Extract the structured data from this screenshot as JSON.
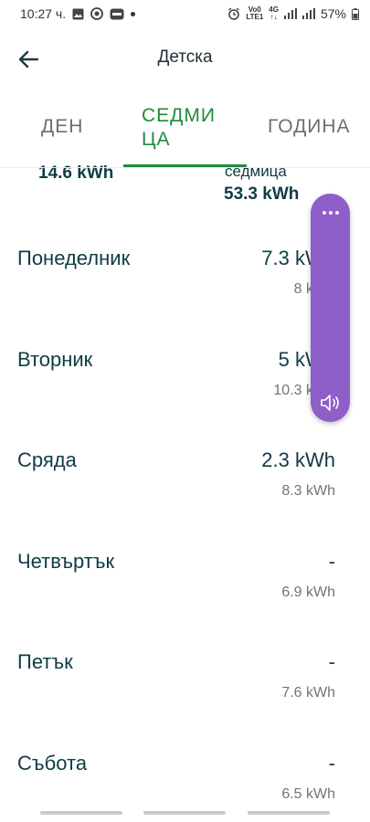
{
  "status_bar": {
    "time": "10:27 ч.",
    "net_top": "Vo0",
    "net_bottom": "LTE1",
    "net2_top": "4G",
    "battery": "57%"
  },
  "app_bar": {
    "title": "Детска"
  },
  "tabs": [
    {
      "label": "ДЕН",
      "active": false
    },
    {
      "label": "СЕДМИ ЦА",
      "active": true
    },
    {
      "label": "ГОДИНА",
      "active": false
    }
  ],
  "summary": {
    "left_value": "14.6 kWh",
    "right_label": "седмица",
    "right_value": "53.3 kWh"
  },
  "days": [
    {
      "name": "Понеделник",
      "value": "7.3 kWh",
      "prev": "8 kWh"
    },
    {
      "name": "Вторник",
      "value": "5 kWh",
      "prev": "10.3 kWh"
    },
    {
      "name": "Сряда",
      "value": "2.3 kWh",
      "prev": "8.3 kWh"
    },
    {
      "name": "Четвъртък",
      "value": "-",
      "prev": "6.9 kWh"
    },
    {
      "name": "Петък",
      "value": "-",
      "prev": "7.6 kWh"
    },
    {
      "name": "Събота",
      "value": "-",
      "prev": "6.5 kWh"
    }
  ],
  "colors": {
    "accent": "#1e8a3e",
    "text": "#0f3c45",
    "overlay": "#8e5ec9"
  }
}
